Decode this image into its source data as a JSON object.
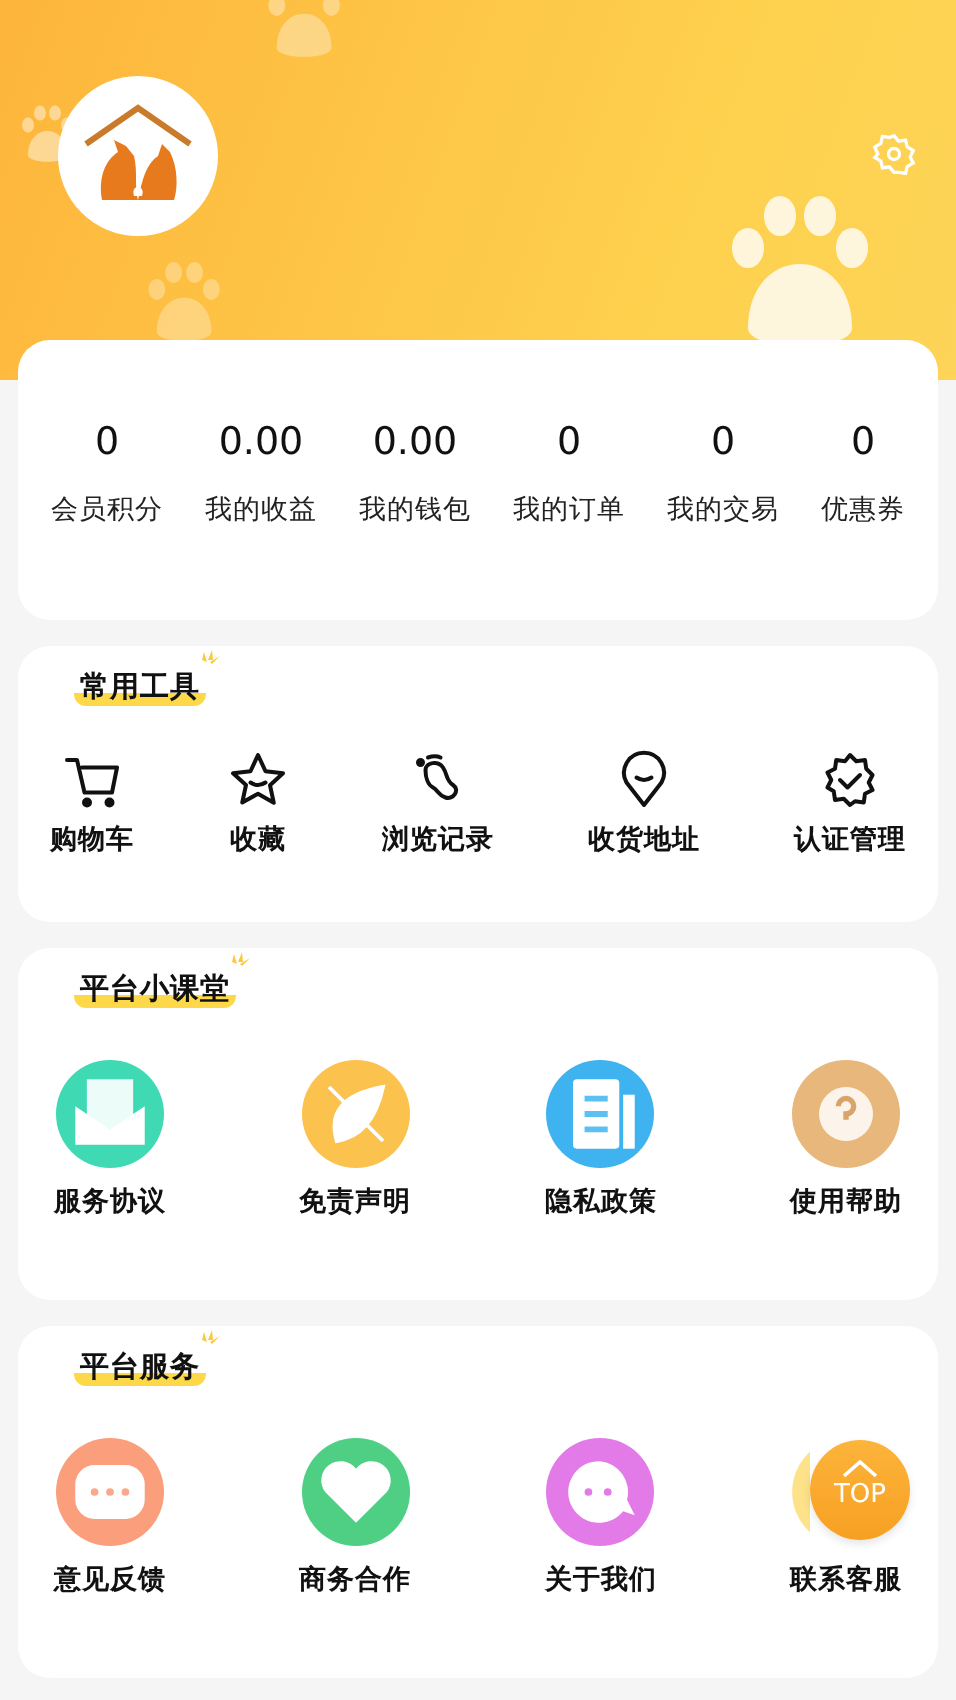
{
  "header": {
    "avatar": {
      "kind": "logo"
    },
    "settings": {
      "kind": "gear"
    }
  },
  "stats": [
    {
      "value": "0",
      "label": "会员积分"
    },
    {
      "value": "0.00",
      "label": "我的收益"
    },
    {
      "value": "0.00",
      "label": "我的钱包"
    },
    {
      "value": "0",
      "label": "我的订单"
    },
    {
      "value": "0",
      "label": "我的交易"
    },
    {
      "value": "0",
      "label": "优惠券"
    }
  ],
  "sections": [
    {
      "title": "常用工具",
      "kind": "line",
      "items": [
        {
          "label": "购物车"
        },
        {
          "label": "收藏"
        },
        {
          "label": "浏览记录"
        },
        {
          "label": "收货地址"
        },
        {
          "label": "认证管理"
        }
      ]
    },
    {
      "title": "平台小课堂",
      "kind": "circle",
      "items": [
        {
          "label": "服务协议",
          "color": "#3fd9b4"
        },
        {
          "label": "免责声明",
          "color": "#fbc24e"
        },
        {
          "label": "隐私政策",
          "color": "#3fb3ef"
        },
        {
          "label": "使用帮助",
          "color": "#e8b77c"
        }
      ]
    },
    {
      "title": "平台服务",
      "kind": "circle",
      "items": [
        {
          "label": "意见反馈",
          "color": "#fb9e7c"
        },
        {
          "label": "商务合作",
          "color": "#4fcf84"
        },
        {
          "label": "关于我们",
          "color": "#e27ae8"
        },
        {
          "label": "联系客服",
          "color": "#fde28a"
        }
      ]
    }
  ],
  "top_button": {
    "label": "TOP"
  }
}
